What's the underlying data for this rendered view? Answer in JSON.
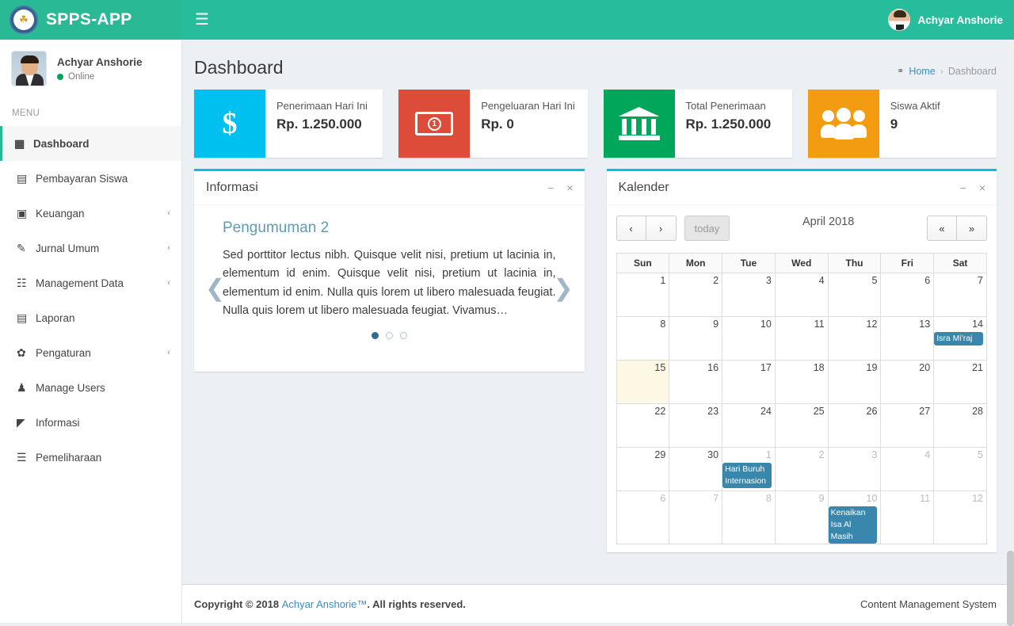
{
  "app": {
    "title": "SPPS-APP",
    "logo_icon": "school-emblem-icon",
    "hamburger_icon": "hamburger-menu-icon"
  },
  "topbar": {
    "user_name": "Achyar Anshorie",
    "avatar_icon": "user-avatar-icon"
  },
  "sidebar": {
    "profile": {
      "name": "Achyar Anshorie",
      "status": "Online"
    },
    "menu_header": "MENU",
    "items": [
      {
        "label": "Dashboard",
        "icon": "grid-icon",
        "active": true,
        "caret": ""
      },
      {
        "label": "Pembayaran Siswa",
        "icon": "credit-card-icon",
        "active": false,
        "caret": ""
      },
      {
        "label": "Keuangan",
        "icon": "money-icon",
        "active": false,
        "caret": "‹"
      },
      {
        "label": "Jurnal Umum",
        "icon": "edit-icon",
        "active": false,
        "caret": "‹"
      },
      {
        "label": "Management Data",
        "icon": "users-icon",
        "active": false,
        "caret": "‹"
      },
      {
        "label": "Laporan",
        "icon": "file-icon",
        "active": false,
        "caret": ""
      },
      {
        "label": "Pengaturan",
        "icon": "gear-icon",
        "active": false,
        "caret": "‹"
      },
      {
        "label": "Manage Users",
        "icon": "user-icon",
        "active": false,
        "caret": ""
      },
      {
        "label": "Informasi",
        "icon": "megaphone-icon",
        "active": false,
        "caret": ""
      },
      {
        "label": "Pemeliharaan",
        "icon": "database-icon",
        "active": false,
        "caret": ""
      }
    ]
  },
  "page": {
    "title": "Dashboard",
    "breadcrumb": {
      "home_icon": "dashboard-speedometer-icon",
      "home": "Home",
      "separator": "›",
      "current": "Dashboard"
    }
  },
  "stats": [
    {
      "label": "Penerimaan Hari Ini",
      "value": "Rp. 1.250.000",
      "color": "#00c0ef",
      "icon": "dollar-sign-icon"
    },
    {
      "label": "Pengeluaran Hari Ini",
      "value": "Rp. 0",
      "color": "#dd4b39",
      "icon": "money-bill-icon"
    },
    {
      "label": "Total Penerimaan",
      "value": "Rp. 1.250.000",
      "color": "#00a65a",
      "icon": "bank-icon"
    },
    {
      "label": "Siswa Aktif",
      "value": "9",
      "color": "#f39c12",
      "icon": "users-group-icon"
    }
  ],
  "informasi": {
    "panel_title": "Informasi",
    "collapse_icon": "−",
    "close_icon": "×",
    "announcement_title": "Pengumuman 2",
    "announcement_text": "Sed porttitor lectus nibh. Quisque velit nisi, pretium ut lacinia in, elementum id enim. Quisque velit nisi, pretium ut lacinia in, elementum id enim. Nulla quis lorem ut libero malesuada feugiat. Nulla quis lorem ut libero malesuada feugiat. Vivamus…",
    "prev_icon": "❮",
    "next_icon": "❯",
    "dots": 3,
    "active_dot": 0
  },
  "kalender": {
    "panel_title": "Kalender",
    "collapse_icon": "−",
    "close_icon": "×",
    "prev_label": "‹",
    "next_label": "›",
    "today_label": "today",
    "month_label": "April 2018",
    "fast_prev_label": "«",
    "fast_next_label": "»",
    "day_names": [
      "Sun",
      "Mon",
      "Tue",
      "Wed",
      "Thu",
      "Fri",
      "Sat"
    ],
    "weeks": [
      [
        {
          "n": "1",
          "other": false,
          "today": false,
          "events": []
        },
        {
          "n": "2",
          "other": false,
          "today": false,
          "events": []
        },
        {
          "n": "3",
          "other": false,
          "today": false,
          "events": []
        },
        {
          "n": "4",
          "other": false,
          "today": false,
          "events": []
        },
        {
          "n": "5",
          "other": false,
          "today": false,
          "events": []
        },
        {
          "n": "6",
          "other": false,
          "today": false,
          "events": []
        },
        {
          "n": "7",
          "other": false,
          "today": false,
          "events": []
        }
      ],
      [
        {
          "n": "8",
          "other": false,
          "today": false,
          "events": []
        },
        {
          "n": "9",
          "other": false,
          "today": false,
          "events": []
        },
        {
          "n": "10",
          "other": false,
          "today": false,
          "events": []
        },
        {
          "n": "11",
          "other": false,
          "today": false,
          "events": []
        },
        {
          "n": "12",
          "other": false,
          "today": false,
          "events": []
        },
        {
          "n": "13",
          "other": false,
          "today": false,
          "events": []
        },
        {
          "n": "14",
          "other": false,
          "today": false,
          "events": [
            "Isra Mi'raj"
          ]
        }
      ],
      [
        {
          "n": "15",
          "other": false,
          "today": true,
          "events": []
        },
        {
          "n": "16",
          "other": false,
          "today": false,
          "events": []
        },
        {
          "n": "17",
          "other": false,
          "today": false,
          "events": []
        },
        {
          "n": "18",
          "other": false,
          "today": false,
          "events": []
        },
        {
          "n": "19",
          "other": false,
          "today": false,
          "events": []
        },
        {
          "n": "20",
          "other": false,
          "today": false,
          "events": []
        },
        {
          "n": "21",
          "other": false,
          "today": false,
          "events": []
        }
      ],
      [
        {
          "n": "22",
          "other": false,
          "today": false,
          "events": []
        },
        {
          "n": "23",
          "other": false,
          "today": false,
          "events": []
        },
        {
          "n": "24",
          "other": false,
          "today": false,
          "events": []
        },
        {
          "n": "25",
          "other": false,
          "today": false,
          "events": []
        },
        {
          "n": "26",
          "other": false,
          "today": false,
          "events": []
        },
        {
          "n": "27",
          "other": false,
          "today": false,
          "events": []
        },
        {
          "n": "28",
          "other": false,
          "today": false,
          "events": []
        }
      ],
      [
        {
          "n": "29",
          "other": false,
          "today": false,
          "events": []
        },
        {
          "n": "30",
          "other": false,
          "today": false,
          "events": []
        },
        {
          "n": "1",
          "other": true,
          "today": false,
          "events": [
            "Hari Buruh Internasion"
          ]
        },
        {
          "n": "2",
          "other": true,
          "today": false,
          "events": []
        },
        {
          "n": "3",
          "other": true,
          "today": false,
          "events": []
        },
        {
          "n": "4",
          "other": true,
          "today": false,
          "events": []
        },
        {
          "n": "5",
          "other": true,
          "today": false,
          "events": []
        }
      ],
      [
        {
          "n": "6",
          "other": true,
          "today": false,
          "events": []
        },
        {
          "n": "7",
          "other": true,
          "today": false,
          "events": []
        },
        {
          "n": "8",
          "other": true,
          "today": false,
          "events": []
        },
        {
          "n": "9",
          "other": true,
          "today": false,
          "events": []
        },
        {
          "n": "10",
          "other": true,
          "today": false,
          "events": [
            "Kenaikan Isa Al Masih"
          ]
        },
        {
          "n": "11",
          "other": true,
          "today": false,
          "events": []
        },
        {
          "n": "12",
          "other": true,
          "today": false,
          "events": []
        }
      ]
    ],
    "event_color": "#3a87ad",
    "today_color": "#fcf8e3"
  },
  "footer": {
    "copyright_prefix": "Copyright © 2018 ",
    "link": "Achyar Anshorie™",
    "copyright_suffix": ". All rights reserved.",
    "right": "Content Management System"
  },
  "colors": {
    "brand_green": "#27bd9c",
    "panel_accent": "#00c0ef",
    "link_blue": "#3c8dbc"
  }
}
